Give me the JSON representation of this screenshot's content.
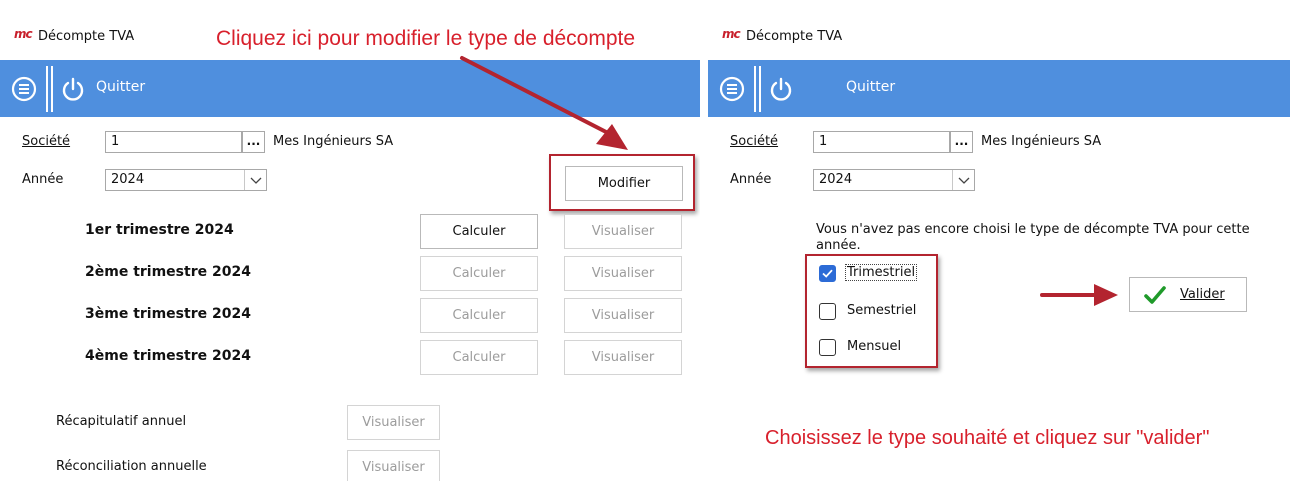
{
  "window_title": "Décompte TVA",
  "logo_text": "mc",
  "toolbar": {
    "quit_label": "Quitter"
  },
  "form": {
    "company_label": "Société",
    "company_value": "1",
    "browse_label": "...",
    "company_name": "Mes Ingénieurs SA",
    "year_label": "Année",
    "year_value": "2024"
  },
  "left": {
    "modify_button": "Modifier",
    "quarters": [
      {
        "label": "1er trimestre 2024",
        "calc": "Calculer",
        "view": "Visualiser"
      },
      {
        "label": "2ème trimestre 2024",
        "calc": "Calculer",
        "view": "Visualiser"
      },
      {
        "label": "3ème trimestre 2024",
        "calc": "Calculer",
        "view": "Visualiser"
      },
      {
        "label": "4ème trimestre 2024",
        "calc": "Calculer",
        "view": "Visualiser"
      }
    ],
    "annual_summary_label": "Récapitulatif annuel",
    "annual_summary_view": "Visualiser",
    "annual_reconciliation_label": "Réconciliation annuelle",
    "annual_reconciliation_view": "Visualiser"
  },
  "right": {
    "message": "Vous n'avez pas encore choisi le type de décompte TVA pour cette année.",
    "options": [
      {
        "label": "Trimestriel",
        "checked": true
      },
      {
        "label": "Semestriel",
        "checked": false
      },
      {
        "label": "Mensuel",
        "checked": false
      }
    ],
    "validate_button": "Valider"
  },
  "annotations": {
    "left_callout": "Cliquez ici pour modifier le type de décompte",
    "right_callout": "Choisissez le type souhaité et cliquez sur \"valider\""
  },
  "colors": {
    "toolbar_blue": "#4f8fde",
    "annotation_red": "#d8202c",
    "checkbox_blue": "#2c6bd6",
    "check_green": "#1f9a2a"
  }
}
